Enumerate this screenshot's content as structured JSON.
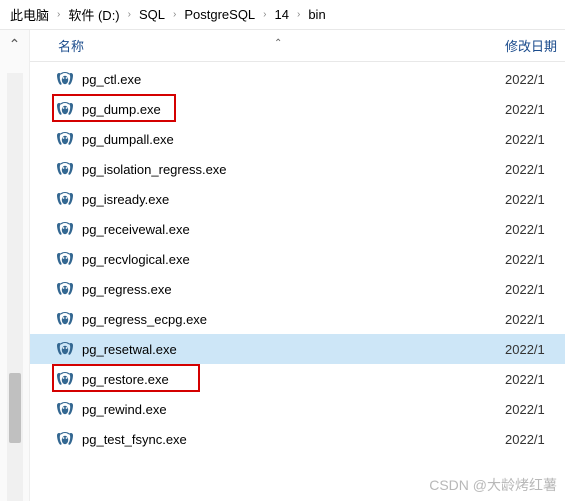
{
  "breadcrumb": {
    "items": [
      {
        "label": "此电脑"
      },
      {
        "label": "软件 (D:)"
      },
      {
        "label": "SQL"
      },
      {
        "label": "PostgreSQL"
      },
      {
        "label": "14"
      },
      {
        "label": "bin"
      }
    ]
  },
  "columns": {
    "name": "名称",
    "date": "修改日期"
  },
  "files": [
    {
      "name": "pg_ctl.exe",
      "date": "2022/1",
      "highlighted": false,
      "selected": false
    },
    {
      "name": "pg_dump.exe",
      "date": "2022/1",
      "highlighted": true,
      "selected": false
    },
    {
      "name": "pg_dumpall.exe",
      "date": "2022/1",
      "highlighted": false,
      "selected": false
    },
    {
      "name": "pg_isolation_regress.exe",
      "date": "2022/1",
      "highlighted": false,
      "selected": false
    },
    {
      "name": "pg_isready.exe",
      "date": "2022/1",
      "highlighted": false,
      "selected": false
    },
    {
      "name": "pg_receivewal.exe",
      "date": "2022/1",
      "highlighted": false,
      "selected": false
    },
    {
      "name": "pg_recvlogical.exe",
      "date": "2022/1",
      "highlighted": false,
      "selected": false
    },
    {
      "name": "pg_regress.exe",
      "date": "2022/1",
      "highlighted": false,
      "selected": false
    },
    {
      "name": "pg_regress_ecpg.exe",
      "date": "2022/1",
      "highlighted": false,
      "selected": false
    },
    {
      "name": "pg_resetwal.exe",
      "date": "2022/1",
      "highlighted": false,
      "selected": true
    },
    {
      "name": "pg_restore.exe",
      "date": "2022/1",
      "highlighted": true,
      "selected": false
    },
    {
      "name": "pg_rewind.exe",
      "date": "2022/1",
      "highlighted": false,
      "selected": false
    },
    {
      "name": "pg_test_fsync.exe",
      "date": "2022/1",
      "highlighted": false,
      "selected": false
    }
  ],
  "watermark": "CSDN @大龄烤红薯",
  "icon_alt": "elephant-icon"
}
